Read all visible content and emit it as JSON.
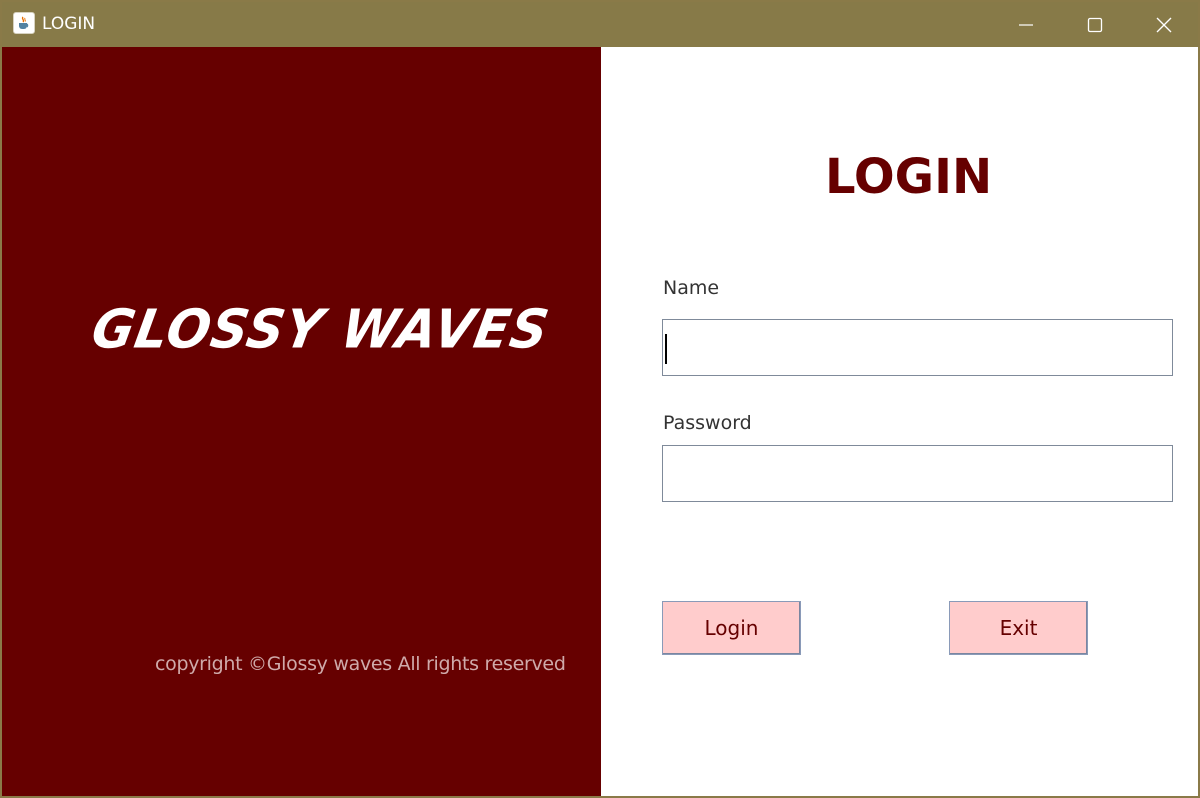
{
  "window": {
    "title": "LOGIN",
    "icon": "java-cup-icon",
    "controls": [
      "minimize-icon",
      "maximize-icon",
      "close-icon"
    ]
  },
  "branding": {
    "name": "GLOSSY WAVES",
    "copyright": "copyright ©Glossy waves All rights reserved"
  },
  "form": {
    "heading": "LOGIN",
    "name_label": "Name",
    "name_value": "",
    "password_label": "Password",
    "password_value": "",
    "login_button": "Login",
    "exit_button": "Exit"
  },
  "colors": {
    "title_bar": "#877a48",
    "brand_panel": "#660000",
    "heading": "#660000",
    "button_bg": "#ffcccc",
    "button_text": "#660000"
  }
}
